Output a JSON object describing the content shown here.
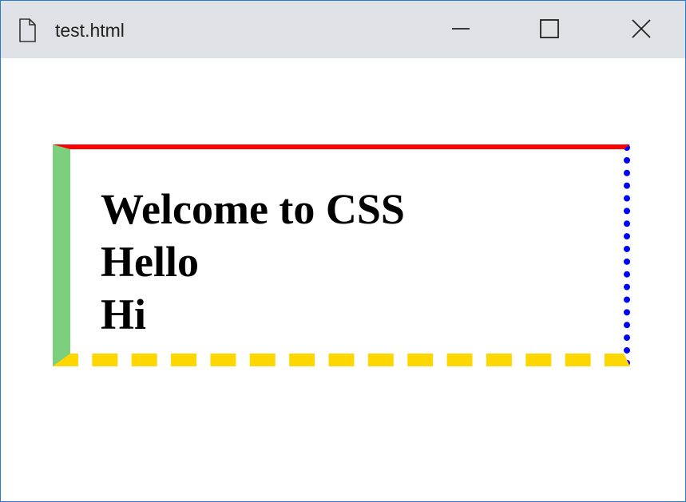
{
  "window": {
    "title": "test.html",
    "icon": "file-icon",
    "controls": {
      "minimize": "minimize-icon",
      "maximize": "maximize-icon",
      "close": "close-icon"
    }
  },
  "box": {
    "lines": [
      "Welcome to CSS",
      "Hello",
      "Hi"
    ],
    "border_colors": {
      "top": "#ff0000",
      "right": "#0000ff",
      "bottom": "#ffd700",
      "left": "#7ccf7c"
    },
    "border_styles": {
      "top": "solid",
      "right": "dotted",
      "bottom": "dashed",
      "left": "outset"
    }
  },
  "colors": {
    "titlebar": "#dee1e6",
    "window_border": "#2b79c9"
  }
}
